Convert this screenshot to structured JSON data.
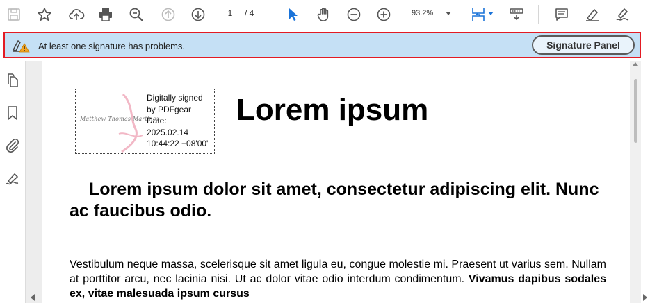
{
  "toolbar": {
    "page_current": "1",
    "page_total": "/ 4",
    "zoom": "93.2%",
    "icons": [
      "save-icon",
      "star-icon",
      "cloud-upload-icon",
      "print-icon",
      "zoom-search-icon",
      "page-up-icon",
      "page-down-icon",
      "select-arrow-icon",
      "hand-icon",
      "zoom-out-icon",
      "zoom-in-icon",
      "fit-page-icon",
      "stamp-icon",
      "comment-icon",
      "highlight-pen-icon",
      "sign-icon"
    ]
  },
  "signature_bar": {
    "message": "At least one signature has problems.",
    "button_label": "Signature Panel",
    "icon": "signature-warning-icon"
  },
  "left_rail": {
    "icons": [
      "pages-icon",
      "bookmark-icon",
      "attachment-icon",
      "signature-icon"
    ]
  },
  "document": {
    "signature_field": {
      "script_name": "Matthew Thomas Martinez",
      "lines": [
        "Digitally signed",
        "by PDFgear",
        "Date:",
        "2025.02.14",
        "10:44:22 +08'00'"
      ]
    },
    "title": "Lorem ipsum",
    "heading": "Lorem ipsum dolor sit amet, consectetur adipiscing elit. Nunc ac faucibus odio.",
    "body_plain": "Vestibulum neque massa, scelerisque sit amet ligula eu, congue molestie mi. Praesent ut varius sem. Nullam at porttitor arcu, nec lacinia nisi. Ut ac dolor vitae odio interdum condimentum. ",
    "body_bold": "Vivamus dapibus sodales ex, vitae malesuada ipsum cursus"
  },
  "colors": {
    "accent_blue": "#1a73d9",
    "sig_bar_bg": "#c5e0f5",
    "highlight_border": "#e31b23"
  }
}
